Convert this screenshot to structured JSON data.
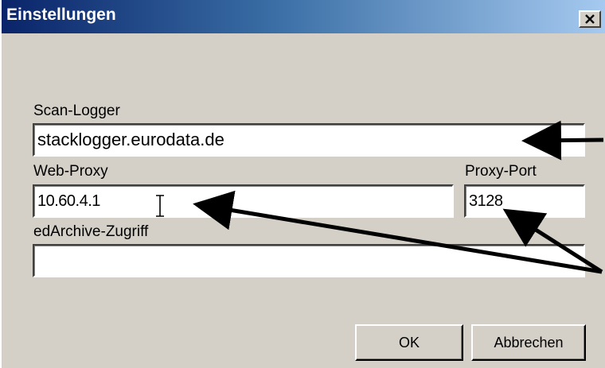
{
  "window": {
    "title": "Einstellungen",
    "close_icon": "close-x-icon"
  },
  "fields": {
    "scan_logger": {
      "label": "Scan-Logger",
      "value": "stacklogger.eurodata.de"
    },
    "web_proxy": {
      "label": "Web-Proxy",
      "value": "10.60.4.1"
    },
    "proxy_port": {
      "label": "Proxy-Port",
      "value": "3128"
    },
    "edarchive": {
      "label": "edArchive-Zugriff",
      "value": ""
    }
  },
  "buttons": {
    "ok_label": "OK",
    "cancel_label": "Abbrechen"
  },
  "colors": {
    "dialog_face": "#d4d0c8",
    "titlebar_start": "#0a246a",
    "titlebar_end": "#a6caf0",
    "annotation_arrow": "#000000"
  }
}
